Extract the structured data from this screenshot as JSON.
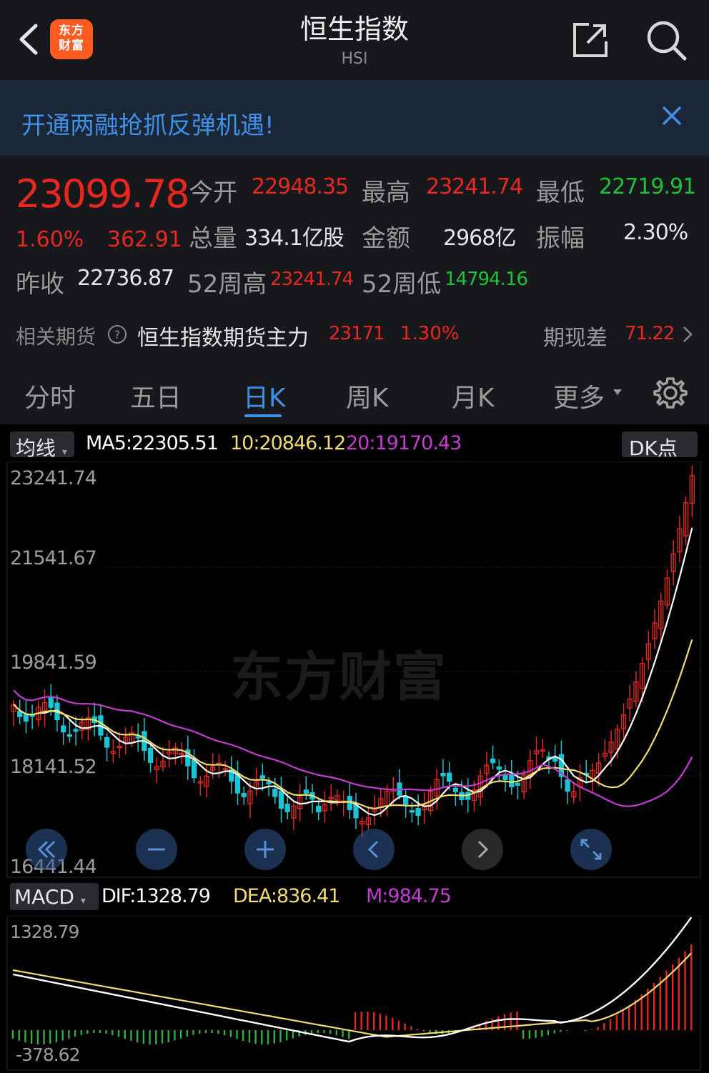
{
  "header": {
    "title": "恒生指数",
    "subtitle": "HSI",
    "logo_line1": "东方",
    "logo_line2": "财富"
  },
  "banner": {
    "text": "开通两融抢抓反弹机遇!"
  },
  "quote": {
    "price": "23099.78",
    "change_pct": "1.60%",
    "change": "362.91",
    "open_label": "今开",
    "open": "22948.35",
    "high_label": "最高",
    "high": "23241.74",
    "low_label": "最低",
    "low": "22719.91",
    "volume_label": "总量",
    "volume": "334.1亿股",
    "amount_label": "金额",
    "amount": "2968亿",
    "amplitude_label": "振幅",
    "amplitude": "2.30%",
    "prev_close_label": "昨收",
    "prev_close": "22736.87",
    "wk52_high_label": "52周高",
    "wk52_high": "23241.74",
    "wk52_low_label": "52周低",
    "wk52_low": "14794.16"
  },
  "futures": {
    "label": "相关期货",
    "name": "恒生指数期货主力",
    "price": "23171",
    "pct": "1.30%",
    "basis_label": "期现差",
    "basis": "71.22"
  },
  "tabs": [
    {
      "label": "分时"
    },
    {
      "label": "五日"
    },
    {
      "label": "日K"
    },
    {
      "label": "周K"
    },
    {
      "label": "月K"
    },
    {
      "label": "更多"
    }
  ],
  "chart": {
    "indicator_pill": "均线",
    "ma5": "MA5:22305.51",
    "ma10": "10:20846.12",
    "ma20": "20:19170.43",
    "dk_pill": "DK点",
    "y_labels": [
      "23241.74",
      "21541.67",
      "19841.59",
      "18141.52",
      "16441.44"
    ],
    "watermark": "东方财富",
    "macd_pill": "MACD",
    "dif": "DIF:1328.79",
    "dea": "DEA:836.41",
    "m": "M:984.75",
    "macd_max": "1328.79",
    "macd_min": "-378.62",
    "colors": {
      "ma5": "#ffffff",
      "ma10": "#f2dc6b",
      "ma20": "#c43bd0",
      "up": "#e8271f",
      "down": "#16c6d4"
    }
  },
  "chart_data": [
    {
      "type": "candlestick",
      "series_lines": [
        "MA5",
        "MA10",
        "MA20"
      ],
      "ylim": [
        16441.44,
        23241.74
      ],
      "last_close": 23099.78
    },
    {
      "type": "bar",
      "series_lines": [
        "DIF",
        "DEA"
      ],
      "ylim": [
        -378.62,
        1328.79
      ]
    }
  ]
}
